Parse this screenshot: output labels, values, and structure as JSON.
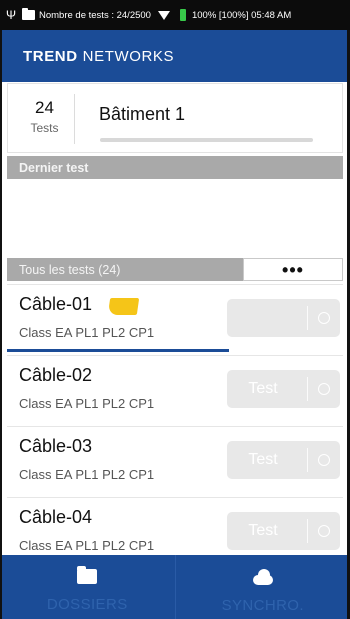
{
  "status_bar": {
    "usb_icon": "usb-icon",
    "folder_icon": "folder-icon",
    "text_left": "Nombre de tests : 24/2500",
    "text_right": "100% [100%] 05:48 AM"
  },
  "app_header": {
    "brand_bold": "TREND",
    "brand_rest": "NETWORKS"
  },
  "summary": {
    "count": "24",
    "count_label": "Tests",
    "site_name": "Bâtiment 1"
  },
  "last_test": {
    "header": "Dernier test"
  },
  "all_tests": {
    "header": "Tous les tests (24)",
    "more_label": "•••"
  },
  "tests": [
    {
      "name": "Câble-01",
      "class": "Class EA PL1 PL2 CP1",
      "button_label": "",
      "tagged": true,
      "progress": 0.66
    },
    {
      "name": "Câble-02",
      "class": "Class EA PL1 PL2 CP1",
      "button_label": "Test"
    },
    {
      "name": "Câble-03",
      "class": "Class EA PL1 PL2 CP1",
      "button_label": "Test"
    },
    {
      "name": "Câble-04",
      "class": "Class EA PL1 PL2 CP1",
      "button_label": "Test"
    }
  ],
  "bottom_nav": [
    {
      "label": "DOSSIERS",
      "icon": "folder-icon"
    },
    {
      "label": "SYNCHRO.",
      "icon": "cloud-icon"
    }
  ],
  "colors": {
    "brand_blue": "#1b4c97",
    "section_gray": "#a9a9a9",
    "tag_yellow": "#f5c518",
    "battery_green": "#38c94a"
  }
}
